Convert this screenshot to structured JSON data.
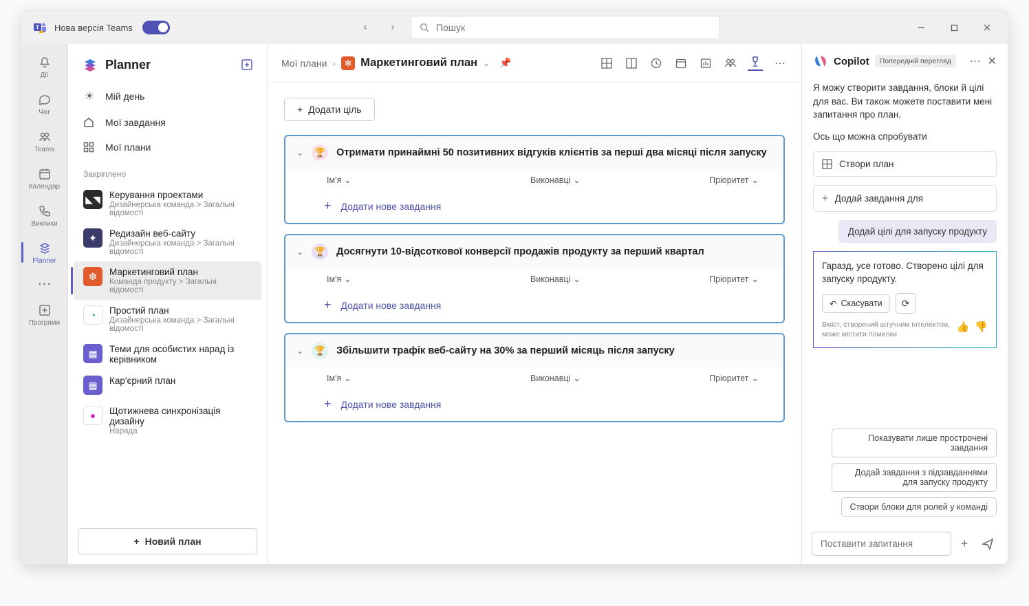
{
  "titlebar": {
    "app_label": "Нова версія Teams",
    "search_placeholder": "Пошук"
  },
  "rail": {
    "items": [
      {
        "label": "Дії"
      },
      {
        "label": "Чат"
      },
      {
        "label": "Teams"
      },
      {
        "label": "Календар"
      },
      {
        "label": "Виклики"
      },
      {
        "label": "Planner"
      },
      {
        "label": "Програми"
      }
    ]
  },
  "sidebar": {
    "title": "Planner",
    "nav": {
      "my_day": "Мій день",
      "my_tasks": "Мої завдання",
      "my_plans": "Мої плани"
    },
    "pinned_label": "Закріплено",
    "pinned": [
      {
        "name": "Керування проектами",
        "sub": "Дизайнерська команда > Загальні відомості",
        "color": "#2b2b2b",
        "tc": "#fff",
        "glyph": "◣◥"
      },
      {
        "name": "Редизайн веб-сайту",
        "sub": "Дизайнерська команда > Загальні відомості",
        "color": "#3b3b6b",
        "tc": "#fff",
        "glyph": "✦"
      },
      {
        "name": "Маркетинговий план",
        "sub": "Команда продукту > Загальні відомості",
        "color": "#e05a2b",
        "tc": "#fff",
        "glyph": "❇"
      },
      {
        "name": "Простий план",
        "sub": "Дизайнерська команда > Загальні відомості",
        "color": "#ffffff",
        "tc": "#2a6",
        "glyph": "◔"
      },
      {
        "name": "Теми для особистих нарад із керівником",
        "sub": "",
        "color": "#6b5fcf",
        "tc": "#fff",
        "glyph": "▦"
      },
      {
        "name": "Кар'єрний план",
        "sub": "",
        "color": "#6b5fcf",
        "tc": "#fff",
        "glyph": "▦"
      },
      {
        "name": "Щотижнева синхронізація дизайну",
        "sub": "Нарада",
        "color": "#ffffff",
        "tc": "#c3c",
        "glyph": "●"
      }
    ],
    "new_plan": "Новий план"
  },
  "plan": {
    "breadcrumb_root": "Мої плани",
    "title": "Маркетинговий план",
    "badge_color": "#e05a2b",
    "add_goal": "Додати ціль",
    "cols": {
      "name": "Ім'я",
      "exec": "Виконавці",
      "prio": "Пріоритет"
    },
    "add_task": "Додати нове завдання",
    "goals": [
      {
        "title": "Отримати принаймні 50 позитивних відгуків клієнтів за перші два місяці після запуску",
        "trophy_bg": "#fbe0ea",
        "trophy_c": "#c94f7c"
      },
      {
        "title": "Досягнути 10-відсоткової конверсії продажів продукту за перший квартал",
        "trophy_bg": "#eadffa",
        "trophy_c": "#7b5bcf"
      },
      {
        "title": "Збільшити трафік веб-сайту на 30% за перший місяць після запуску",
        "trophy_bg": "#dff3f0",
        "trophy_c": "#2fa08a"
      }
    ]
  },
  "copilot": {
    "title": "Copilot",
    "badge": "Попередній перегляд",
    "intro": "Я можу створити завдання, блоки й цілі для вас. Ви також можете поставити мені запитання про план.",
    "try_label": "Ось що можна спробувати",
    "suggestions": [
      "Створи план",
      "Додай завдання для"
    ],
    "user_msg": "Додай цілі для запуску продукту",
    "ai_msg": "Гаразд, усе готово. Створено цілі для запуску продукту.",
    "undo": "Скасувати",
    "disclaimer": "Вміст, створений штучним інтелектом, може містити помилки",
    "quick_prompts": [
      "Показувати лише прострочені завдання",
      "Додай завдання з підзавданнями для запуску продукту",
      "Створи блоки для ролей у команді"
    ],
    "input_placeholder": "Поставити запитання"
  }
}
